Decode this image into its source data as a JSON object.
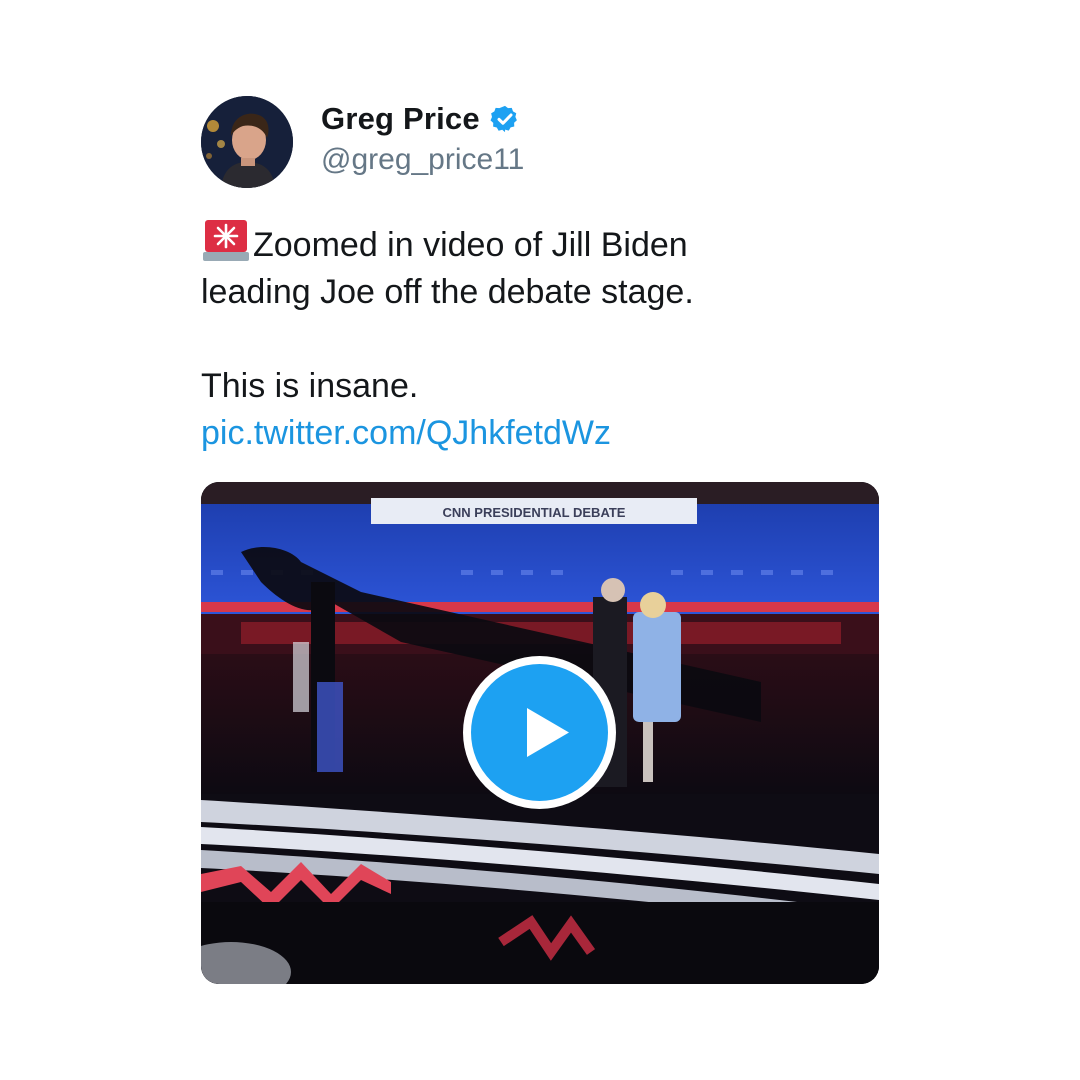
{
  "user": {
    "display_name": "Greg Price",
    "handle": "@greg_price11",
    "verified": true,
    "avatar_icon": "profile-photo"
  },
  "tweet": {
    "emoji": "rotating-light",
    "line1": "Zoomed in video of Jill Biden",
    "line2": "leading Joe off the debate stage.",
    "line3": "This is insane.",
    "link": "pic.twitter.com/QJhkfetdWz"
  },
  "media": {
    "type": "video",
    "banner_text": "CNN PRESIDENTIAL DEBATE",
    "play_icon": "play-icon"
  },
  "colors": {
    "link": "#1b95e0",
    "verified_badge": "#1da1f2",
    "play_button": "#1da1f2",
    "handle": "#657786"
  }
}
